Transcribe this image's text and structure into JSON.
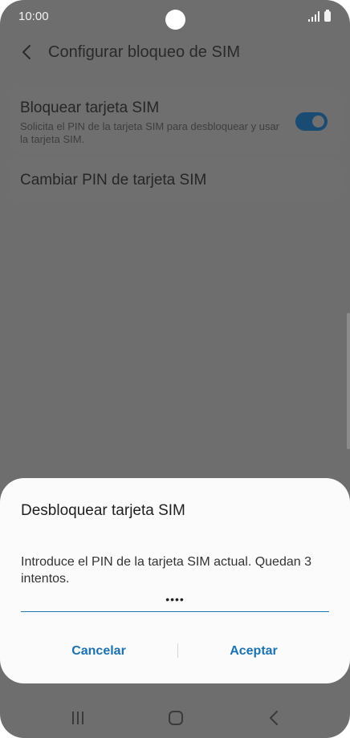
{
  "status_bar": {
    "time": "10:00",
    "icons": [
      "camera-hole",
      "signal-icon",
      "battery-icon"
    ]
  },
  "app_bar": {
    "back_icon": "back-arrow-icon",
    "title": "Configurar bloqueo de SIM"
  },
  "settings": {
    "lock_sim": {
      "title": "Bloquear tarjeta SIM",
      "subtitle": "Solicita el PIN de la tarjeta SIM para desbloquear y usar la tarjeta SIM.",
      "enabled": true
    },
    "change_pin": {
      "title": "Cambiar PIN de tarjeta SIM"
    }
  },
  "dialog": {
    "title": "Desbloquear tarjeta SIM",
    "message": "Introduce el PIN de la tarjeta SIM actual. Quedan 3 intentos.",
    "pin_value": "••••",
    "cancel_label": "Cancelar",
    "accept_label": "Aceptar"
  },
  "nav_bar": {
    "icons": [
      "recent-apps-icon",
      "home-icon",
      "back-icon"
    ]
  },
  "colors": {
    "accent": "#1b72b0",
    "scrim_bg": "#6e6e6e",
    "dialog_bg": "#fbfbfb",
    "toggle_on": "#1a4b72"
  }
}
